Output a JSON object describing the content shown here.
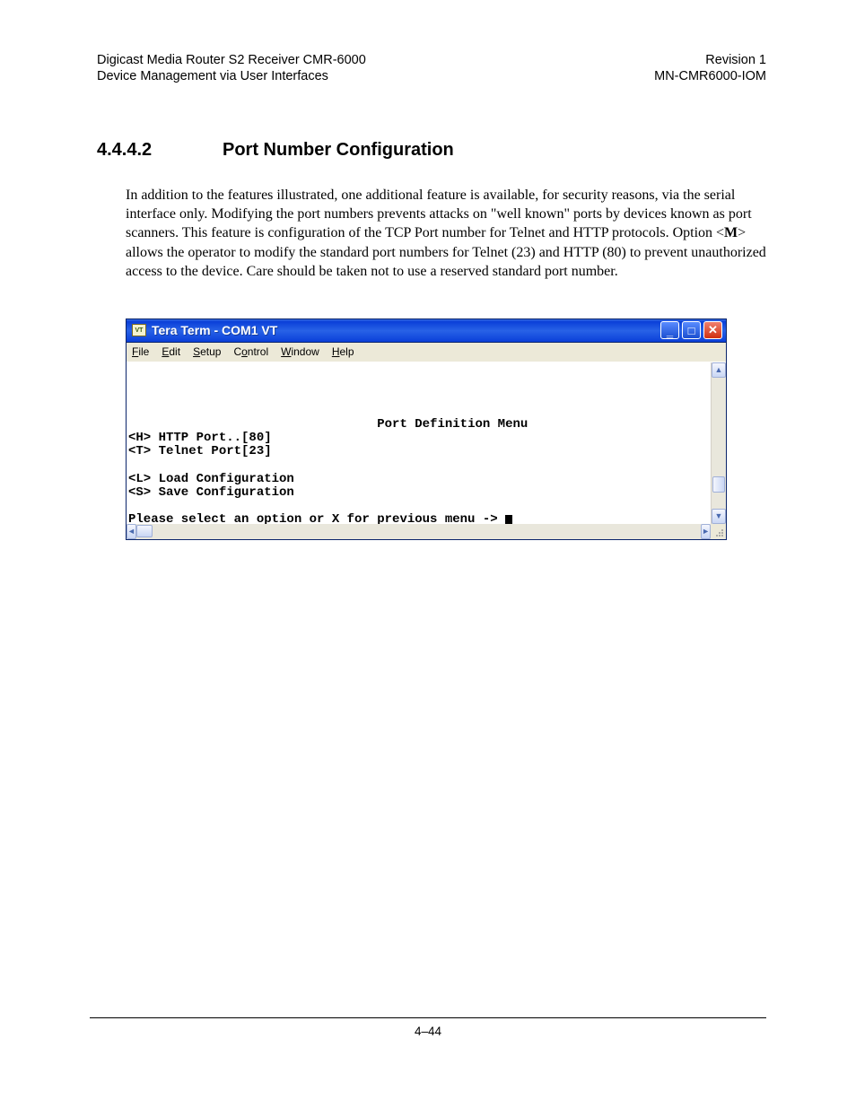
{
  "header": {
    "left_line1": "Digicast Media Router S2 Receiver CMR-6000",
    "left_line2": "Device Management via User Interfaces",
    "right_line1": "Revision 1",
    "right_line2": "MN-CMR6000-IOM"
  },
  "section": {
    "number": "4.4.4.2",
    "title": "Port Number Configuration",
    "para_before": "In addition to the features illustrated, one additional feature is available, for security reasons, via the serial interface only. Modifying the port numbers prevents attacks on \"well known\" ports by devices known as port scanners.  This feature is configuration of the TCP Port number for Telnet and HTTP protocols. Option <",
    "option_letter": "M",
    "para_after": "> allows the operator to modify the standard port numbers for Telnet (23) and HTTP (80) to prevent unauthorized access to the device. Care should be taken not to use a reserved standard port number."
  },
  "window": {
    "title": "Tera Term - COM1 VT",
    "icon_text": "VT",
    "menus": {
      "file": "File",
      "edit": "Edit",
      "setup": "Setup",
      "control": "Control",
      "window": "Window",
      "help": "Help"
    },
    "terminal": {
      "menu_title": "Port Definition Menu",
      "line_http": "<H> HTTP Port..[80]",
      "line_telnet": "<T> Telnet Port[23]",
      "line_load": "<L> Load Configuration",
      "line_save": "<S> Save Configuration",
      "prompt": "Please select an option or X for previous menu -> "
    }
  },
  "footer": {
    "page": "4–44"
  }
}
